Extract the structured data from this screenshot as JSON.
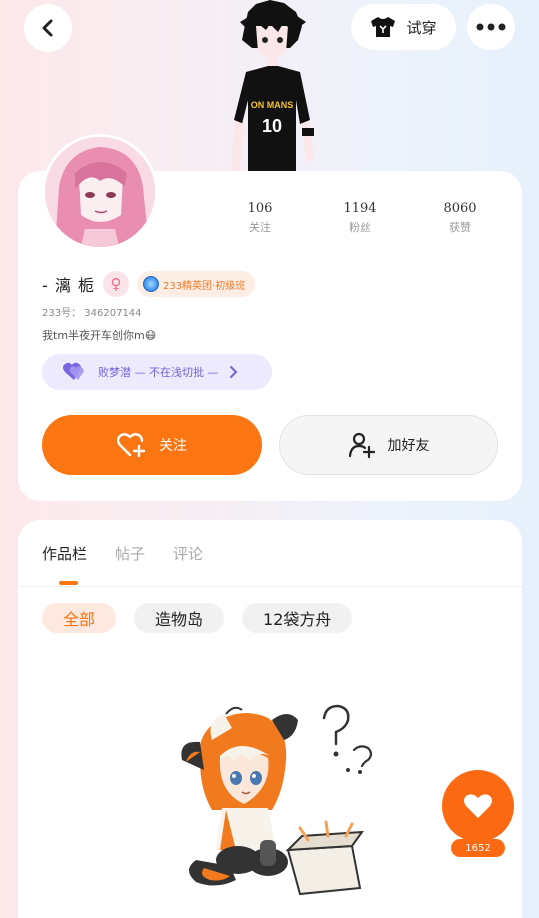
{
  "header": {
    "tryon_label": "试穿",
    "back_icon": "chevron-left-icon",
    "tryon_icon": "tshirt-icon",
    "more_icon": "more-dots-icon",
    "figure_jersey": "10",
    "figure_text": "ON MANS"
  },
  "profile": {
    "nickname": "- 漓 栀",
    "gender_symbol": "♀",
    "badge_label": "233精英团·初级班",
    "uid": "233号： 346207144",
    "bio": "我tm半夜开车创你m😷",
    "fan_club_label": "败梦潜 — 不在浅切批 —",
    "stats": [
      {
        "value": "106",
        "label": "关注"
      },
      {
        "value": "1194",
        "label": "粉丝"
      },
      {
        "value": "8060",
        "label": "获赞"
      }
    ],
    "follow_label": "关注",
    "add_friend_label": "加好友"
  },
  "content": {
    "tabs": [
      {
        "label": "作品栏",
        "active": true
      },
      {
        "label": "帖子",
        "active": false
      },
      {
        "label": "评论",
        "active": false
      }
    ],
    "filters": [
      {
        "label": "全部",
        "active": true
      },
      {
        "label": "造物岛",
        "active": false
      },
      {
        "label": "12袋方舟",
        "active": false
      }
    ]
  },
  "floating_like": {
    "count": "1652"
  },
  "colors": {
    "accent": "#fb7512",
    "pill_purple": "#7264d9",
    "gender_pink": "#f06e8c"
  }
}
